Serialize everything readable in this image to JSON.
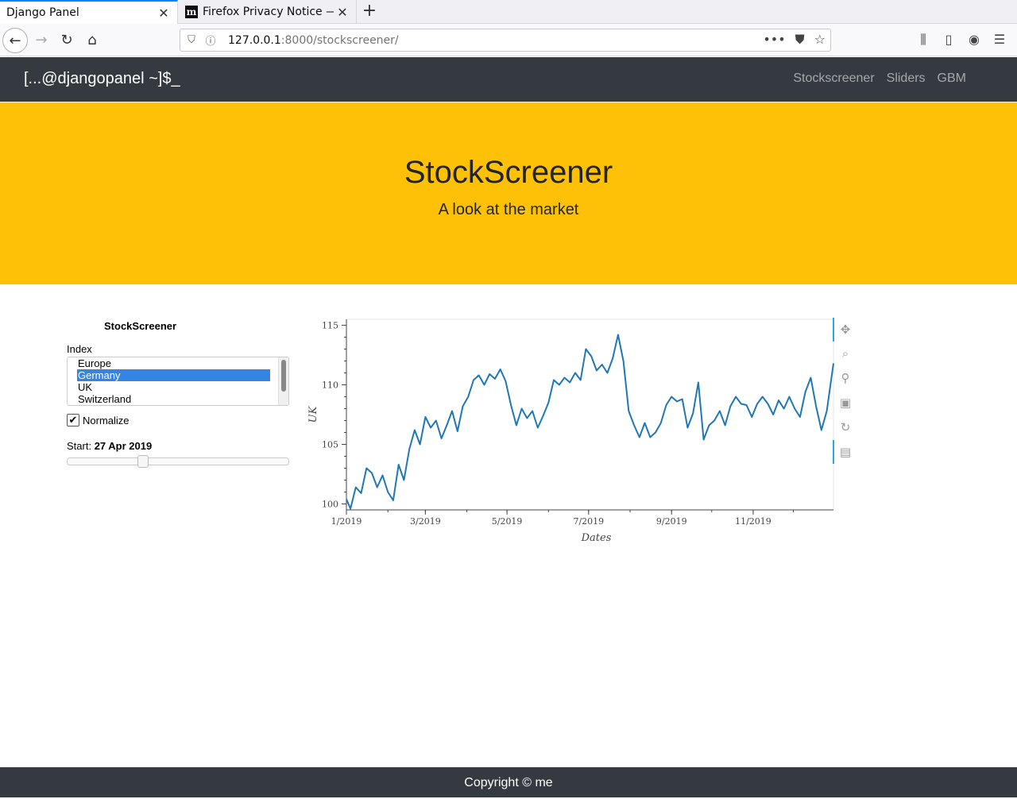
{
  "browser": {
    "tabs": [
      {
        "title": "Django Panel",
        "active": true
      },
      {
        "title": "Firefox Privacy Notice —",
        "active": false,
        "favicon": "m"
      }
    ],
    "url_host": "127.0.0.1",
    "url_rest": ":8000/stockscreener/"
  },
  "navbar": {
    "brand": "[...@djangopanel ~]$_",
    "links": [
      "Stockscreener",
      "Sliders",
      "GBM"
    ]
  },
  "hero": {
    "title": "StockScreener",
    "subtitle": "A look at the market"
  },
  "widgets": {
    "title": "StockScreener",
    "index_label": "Index",
    "index_options": [
      "Europe",
      "Germany",
      "UK",
      "Switzerland"
    ],
    "index_selected": "Germany",
    "normalize_label": "Normalize",
    "normalize_checked": true,
    "start_label": "Start:",
    "start_value": "27 Apr 2019",
    "slider_fraction": 0.33
  },
  "chart_data": {
    "type": "line",
    "xlabel": "Dates",
    "ylabel": "UK",
    "x_ticks": [
      "1/2019",
      "3/2019",
      "5/2019",
      "7/2019",
      "9/2019",
      "11/2019"
    ],
    "y_ticks": [
      "100",
      "105",
      "110",
      "115"
    ],
    "ylim": [
      99.5,
      115.5
    ],
    "xlim": [
      "2019-01-01",
      "2019-12-31"
    ],
    "line_color": "#1f77b4",
    "series": [
      {
        "x": [
          "2019-01-01",
          "2019-01-04",
          "2019-01-08",
          "2019-01-12",
          "2019-01-16",
          "2019-01-20",
          "2019-01-24",
          "2019-01-28",
          "2019-02-01",
          "2019-02-05",
          "2019-02-09",
          "2019-02-13",
          "2019-02-17",
          "2019-02-21",
          "2019-02-25",
          "2019-03-01",
          "2019-03-05",
          "2019-03-09",
          "2019-03-13",
          "2019-03-17",
          "2019-03-21",
          "2019-03-25",
          "2019-03-29",
          "2019-04-02",
          "2019-04-06",
          "2019-04-10",
          "2019-04-14",
          "2019-04-18",
          "2019-04-22",
          "2019-04-26",
          "2019-04-30",
          "2019-05-04",
          "2019-05-08",
          "2019-05-12",
          "2019-05-16",
          "2019-05-20",
          "2019-05-24",
          "2019-05-28",
          "2019-06-01",
          "2019-06-05",
          "2019-06-09",
          "2019-06-13",
          "2019-06-17",
          "2019-06-21",
          "2019-06-25",
          "2019-06-29",
          "2019-07-03",
          "2019-07-07",
          "2019-07-11",
          "2019-07-15",
          "2019-07-19",
          "2019-07-23",
          "2019-07-27",
          "2019-07-31",
          "2019-08-04",
          "2019-08-08",
          "2019-08-12",
          "2019-08-16",
          "2019-08-20",
          "2019-08-24",
          "2019-08-28",
          "2019-09-01",
          "2019-09-05",
          "2019-09-09",
          "2019-09-13",
          "2019-09-17",
          "2019-09-21",
          "2019-09-25",
          "2019-09-29",
          "2019-10-03",
          "2019-10-07",
          "2019-10-11",
          "2019-10-15",
          "2019-10-19",
          "2019-10-23",
          "2019-10-27",
          "2019-10-31",
          "2019-11-04",
          "2019-11-08",
          "2019-11-12",
          "2019-11-16",
          "2019-11-20",
          "2019-11-24",
          "2019-11-28",
          "2019-12-02",
          "2019-12-06",
          "2019-12-10",
          "2019-12-14",
          "2019-12-18",
          "2019-12-22",
          "2019-12-26",
          "2019-12-31"
        ],
        "y": [
          100.4,
          99.6,
          101.4,
          100.9,
          103.0,
          102.6,
          101.4,
          102.4,
          101.0,
          100.3,
          103.3,
          102.0,
          104.6,
          106.2,
          105.0,
          107.3,
          106.4,
          107.0,
          105.5,
          106.6,
          107.8,
          106.1,
          108.2,
          109.0,
          110.4,
          110.8,
          110.0,
          110.9,
          110.5,
          111.3,
          110.3,
          108.3,
          106.6,
          108.0,
          107.2,
          107.8,
          106.4,
          107.4,
          108.5,
          110.4,
          110.0,
          110.6,
          110.2,
          111.0,
          110.4,
          113.0,
          112.4,
          111.2,
          111.7,
          111.0,
          112.2,
          114.2,
          112.0,
          107.8,
          106.6,
          105.6,
          106.8,
          105.6,
          106.0,
          106.8,
          108.3,
          109.0,
          108.6,
          108.8,
          106.4,
          107.6,
          110.2,
          105.4,
          106.6,
          107.0,
          107.8,
          106.6,
          108.2,
          109.0,
          108.4,
          108.3,
          107.3,
          108.4,
          109.0,
          108.4,
          107.5,
          108.7,
          108.0,
          109.0,
          108.0,
          107.3,
          109.4,
          110.6,
          108.2,
          106.2,
          107.8,
          111.8
        ]
      }
    ]
  }
}
